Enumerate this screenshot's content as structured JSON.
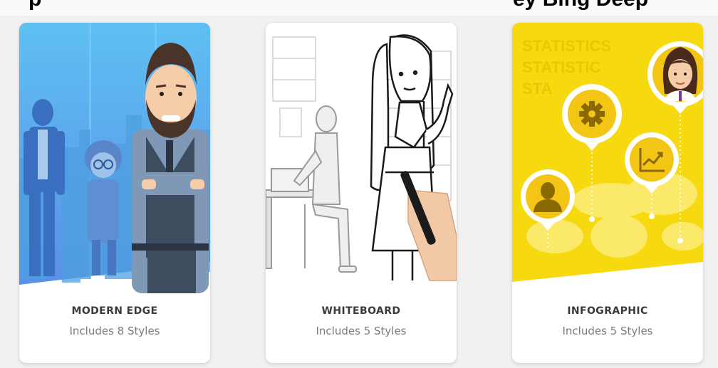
{
  "heading": {
    "left_fragment": "p",
    "right_fragment": "ey Bing Deep"
  },
  "cards": [
    {
      "title": "MODERN EDGE",
      "subtitle": "Includes 8 Styles",
      "illustration": "modern-edge-characters"
    },
    {
      "title": "WHITEBOARD",
      "subtitle": "Includes 5 Styles",
      "illustration": "whiteboard-hand-drawing"
    },
    {
      "title": "INFOGRAPHIC",
      "subtitle": "Includes 5 Styles",
      "illustration": "infographic-map-pins"
    }
  ],
  "infographic_bg_text": [
    "STATISTICS",
    "STATISTIC",
    "STA"
  ],
  "colors": {
    "modern_sky": "#6fb8ef",
    "infographic_yellow": "#f6d90f",
    "title_text": "#3a3a3a",
    "subtitle_text": "#7a7a7a"
  }
}
